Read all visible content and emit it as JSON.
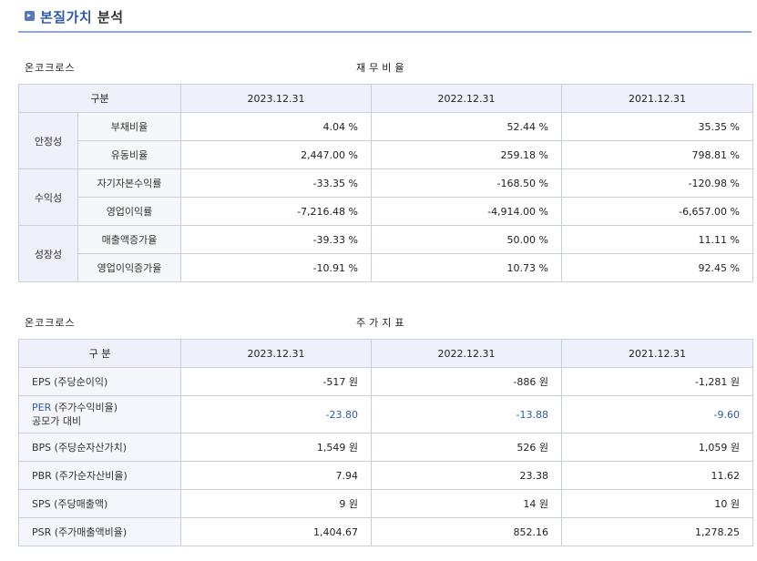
{
  "header": {
    "title_highlight": "본질가치",
    "title_rest": " 분석"
  },
  "ratios": {
    "company": "온코크로스",
    "section": "재무비율",
    "col_label": "구분",
    "dates": [
      "2023.12.31",
      "2022.12.31",
      "2021.12.31"
    ],
    "groups": [
      {
        "name": "안정성",
        "rows": [
          {
            "label": "부채비율",
            "values": [
              "4.04 %",
              "52.44 %",
              "35.35 %"
            ]
          },
          {
            "label": "유동비율",
            "values": [
              "2,447.00 %",
              "259.18 %",
              "798.81 %"
            ]
          }
        ]
      },
      {
        "name": "수익성",
        "rows": [
          {
            "label": "자기자본수익률",
            "values": [
              "-33.35 %",
              "-168.50 %",
              "-120.98 %"
            ]
          },
          {
            "label": "영업이익률",
            "values": [
              "-7,216.48 %",
              "-4,914.00 %",
              "-6,657.00 %"
            ]
          }
        ]
      },
      {
        "name": "성장성",
        "rows": [
          {
            "label": "매출액증가율",
            "values": [
              "-39.33 %",
              "50.00 %",
              "11.11 %"
            ]
          },
          {
            "label": "영업이익증가율",
            "values": [
              "-10.91 %",
              "10.73 %",
              "92.45 %"
            ]
          }
        ]
      }
    ]
  },
  "stock": {
    "company": "온코크로스",
    "section": "주가지표",
    "col_label": "구 분",
    "dates": [
      "2023.12.31",
      "2022.12.31",
      "2021.12.31"
    ],
    "rows": [
      {
        "label": "EPS (주당순이익)",
        "values": [
          "-517 원",
          "-886 원",
          "-1,281 원"
        ]
      },
      {
        "label_prefix": "PER",
        "label": " (주가수익비율)",
        "label_line2": "공모가 대비",
        "values": [
          "-23.80",
          "-13.88",
          "-9.60"
        ]
      },
      {
        "label": "BPS (주당순자산가치)",
        "values": [
          "1,549 원",
          "526 원",
          "1,059 원"
        ]
      },
      {
        "label": "PBR (주가순자산비율)",
        "values": [
          "7.94",
          "23.38",
          "11.62"
        ]
      },
      {
        "label": "SPS (주당매출액)",
        "values": [
          "9 원",
          "14 원",
          "10 원"
        ]
      },
      {
        "label": "PSR (주가매출액비율)",
        "values": [
          "1,404.67",
          "852.16",
          "1,278.25"
        ]
      }
    ]
  },
  "colors": {
    "accent": "#2e5aac",
    "header_bg": "#eef1fa",
    "border": "#c8d0e0"
  }
}
